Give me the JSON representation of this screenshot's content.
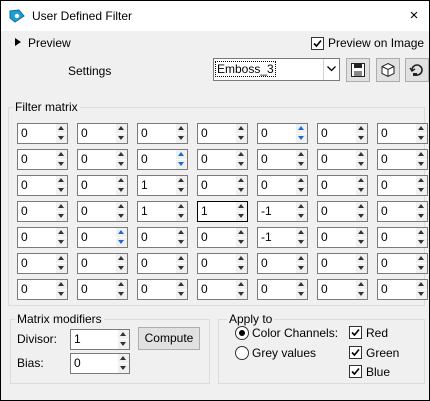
{
  "window": {
    "title": "User Defined Filter",
    "close_glyph": "×"
  },
  "preview": {
    "toggle_label": "Preview",
    "preview_on_image_label": "Preview on Image",
    "preview_on_image_checked": true
  },
  "settings": {
    "label": "Settings",
    "selected": "Emboss_3",
    "buttons": [
      "save-preset-icon",
      "load-preset-icon",
      "reset-defaults-icon"
    ]
  },
  "filter_matrix": {
    "label": "Filter matrix",
    "rows": [
      [
        "0",
        "0",
        "0",
        "0",
        "0",
        "0",
        "0"
      ],
      [
        "0",
        "0",
        "0",
        "0",
        "0",
        "0",
        "0"
      ],
      [
        "0",
        "0",
        "1",
        "0",
        "0",
        "0",
        "0"
      ],
      [
        "0",
        "0",
        "1",
        "1",
        "-1",
        "0",
        "0"
      ],
      [
        "0",
        "0",
        "0",
        "0",
        "-1",
        "0",
        "0"
      ],
      [
        "0",
        "0",
        "0",
        "0",
        "0",
        "0",
        "0"
      ],
      [
        "0",
        "0",
        "0",
        "0",
        "0",
        "0",
        "0"
      ]
    ]
  },
  "matrix_modifiers": {
    "label": "Matrix modifiers",
    "divisor_label": "Divisor:",
    "divisor": "1",
    "bias_label": "Bias:",
    "bias": "0",
    "compute_label": "Compute"
  },
  "apply_to": {
    "label": "Apply to",
    "color_channels_label": "Color Channels:",
    "grey_values_label": "Grey values",
    "selected_mode": "color_channels",
    "channels": [
      {
        "label": "Red",
        "checked": true
      },
      {
        "label": "Green",
        "checked": true
      },
      {
        "label": "Blue",
        "checked": true
      }
    ]
  },
  "colors": {
    "window_bg": "#f0f0f0",
    "icon_accent": "#1a9fd8"
  }
}
